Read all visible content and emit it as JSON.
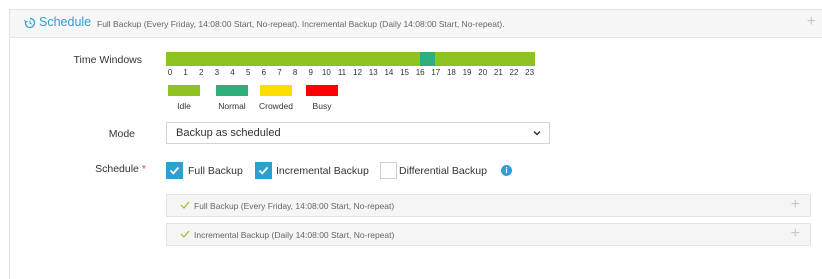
{
  "header": {
    "title": "Schedule",
    "summary": "Full Backup (Every Friday, 14:08:00 Start, No-repeat). Incremental Backup (Daily 14:08:00 Start, No-repeat).",
    "expand_symbol": "+"
  },
  "time_windows": {
    "label": "Time Windows",
    "hours": [
      "0",
      "1",
      "2",
      "3",
      "4",
      "5",
      "6",
      "7",
      "8",
      "9",
      "10",
      "11",
      "12",
      "13",
      "14",
      "15",
      "16",
      "17",
      "18",
      "19",
      "20",
      "21",
      "22",
      "23"
    ],
    "cell_status": [
      "idle",
      "idle",
      "idle",
      "idle",
      "idle",
      "idle",
      "idle",
      "idle",
      "idle",
      "idle",
      "idle",
      "idle",
      "idle",
      "idle",
      "idle",
      "idle",
      "idle",
      "idle",
      "idle",
      "idle",
      "idle",
      "idle",
      "idle",
      "idle",
      "idle",
      "idle",
      "idle",
      "idle",
      "idle",
      "idle",
      "idle",
      "idle",
      "idle",
      "normal",
      "normal",
      "idle",
      "idle",
      "idle",
      "idle",
      "idle",
      "idle",
      "idle",
      "idle",
      "idle",
      "idle",
      "idle",
      "idle",
      "idle"
    ],
    "legend": [
      {
        "key": "idle",
        "label": "Idle",
        "color": "#8ec21f"
      },
      {
        "key": "normal",
        "label": "Normal",
        "color": "#2dae7b"
      },
      {
        "key": "crowded",
        "label": "Crowded",
        "color": "#fedd00"
      },
      {
        "key": "busy",
        "label": "Busy",
        "color": "#ff0000"
      }
    ]
  },
  "mode": {
    "label": "Mode",
    "value": "Backup as scheduled"
  },
  "schedule": {
    "label": "Schedule",
    "required_mark": "*",
    "options": [
      {
        "label": "Full Backup",
        "checked": true
      },
      {
        "label": "Incremental Backup",
        "checked": true
      },
      {
        "label": "Differential Backup",
        "checked": false
      }
    ],
    "info_symbol": "i",
    "entries": [
      {
        "text": "Full Backup (Every Friday, 14:08:00 Start, No-repeat)",
        "expand_symbol": "+"
      },
      {
        "text": "Incremental Backup (Daily 14:08:00 Start, No-repeat)",
        "expand_symbol": "+"
      }
    ]
  },
  "colors": {
    "accent": "#2f9fd3",
    "required": "#e4393c"
  }
}
